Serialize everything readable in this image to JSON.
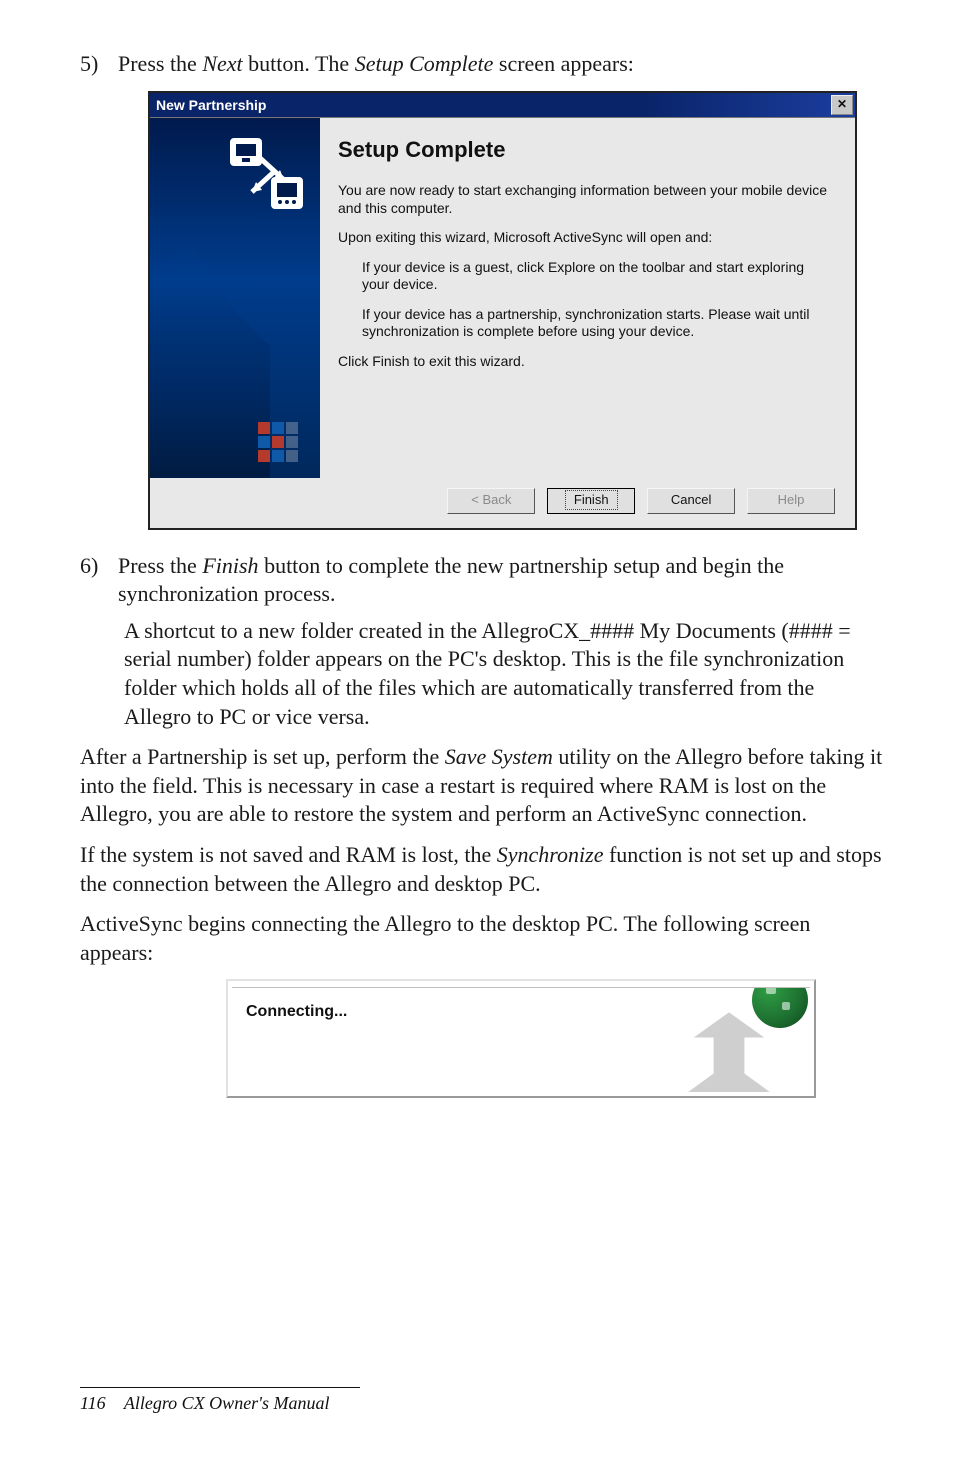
{
  "step5": {
    "num": "5)",
    "text_before": "Press the ",
    "em1": "Next",
    "mid": " button. The ",
    "em2": "Setup Complete",
    "after": " screen appears:"
  },
  "wizard": {
    "title": "New Partnership",
    "heading": "Setup Complete",
    "p1": "You are now ready to start exchanging information between your mobile device and this computer.",
    "p2": "Upon exiting this wizard, Microsoft ActiveSync will open and:",
    "p3": "If your device is a guest, click Explore on the toolbar and start exploring your device.",
    "p4": "If your device has a partnership, synchronization starts. Please wait until synchronization is complete before using your device.",
    "p5": "Click Finish to exit this wizard.",
    "buttons": {
      "back": "< Back",
      "finish": "Finish",
      "cancel": "Cancel",
      "help": "Help"
    }
  },
  "step6": {
    "num": "6)",
    "text_before": "Press the ",
    "em1": "Finish",
    "after": " button to complete the new partnership setup and begin the synchronization process."
  },
  "step6b": "A shortcut to a new folder created in the AllegroCX_#### My Documents (#### = serial number) folder appears on the PC's desktop. This is the file synchronization folder which holds all of the files which are automatically transferred from the Allegro to PC or vice versa.",
  "paraA_before": "After a Partnership is set up, perform the ",
  "paraA_em": "Save System",
  "paraA_after": " utility on the Allegro before taking it into the field. This is necessary in case a restart is required where RAM is lost on the Allegro, you are able to restore the system and perform an ActiveSync connection.",
  "paraB_before": "If the system is not saved and RAM is lost, the ",
  "paraB_em": "Synchronize",
  "paraB_after": " function is not set up and stops the connection between the Allegro and desktop PC.",
  "paraC": "ActiveSync begins connecting the Allegro to the desktop PC. The following screen appears:",
  "connecting": {
    "label": "Connecting..."
  },
  "footer": {
    "page": "116",
    "title": "Allegro CX Owner's Manual"
  }
}
